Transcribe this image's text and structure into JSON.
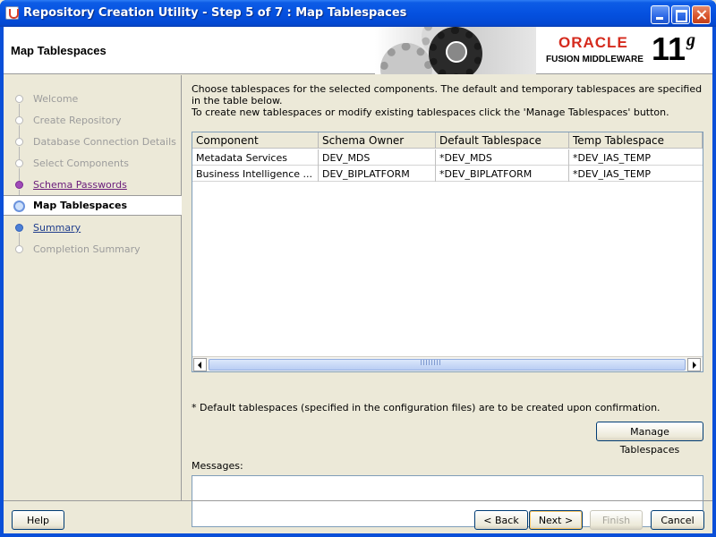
{
  "window": {
    "title": "Repository Creation Utility - Step 5 of 7 : Map Tablespaces"
  },
  "header": {
    "title": "Map Tablespaces",
    "brand": "ORACLE",
    "product": "FUSION MIDDLEWARE",
    "version": "11",
    "version_suffix": "g"
  },
  "nav": {
    "items": [
      {
        "label": "Welcome",
        "state": "done"
      },
      {
        "label": "Create Repository",
        "state": "done"
      },
      {
        "label": "Database Connection Details",
        "state": "done"
      },
      {
        "label": "Select Components",
        "state": "done"
      },
      {
        "label": "Schema Passwords",
        "state": "visited"
      },
      {
        "label": "Map Tablespaces",
        "state": "active"
      },
      {
        "label": "Summary",
        "state": "link"
      },
      {
        "label": "Completion Summary",
        "state": "disabled"
      }
    ]
  },
  "main": {
    "intro_line1": "Choose tablespaces for the selected components. The default and temporary tablespaces are specified in the table below.",
    "intro_line2": "To create new tablespaces or modify existing tablespaces click the 'Manage Tablespaces' button.",
    "table": {
      "columns": [
        "Component",
        "Schema Owner",
        "Default Tablespace",
        "Temp Tablespace"
      ],
      "rows": [
        [
          "Metadata Services",
          "DEV_MDS",
          "*DEV_MDS",
          "*DEV_IAS_TEMP"
        ],
        [
          "Business Intelligence ...",
          "DEV_BIPLATFORM",
          "*DEV_BIPLATFORM",
          "*DEV_IAS_TEMP"
        ]
      ]
    },
    "footnote": "* Default tablespaces (specified in the configuration files) are to be created upon confirmation.",
    "manage_button": "Manage Tablespaces",
    "messages_label": "Messages:"
  },
  "footer": {
    "help": "Help",
    "back": "< Back",
    "next": "Next >",
    "finish": "Finish",
    "cancel": "Cancel"
  }
}
